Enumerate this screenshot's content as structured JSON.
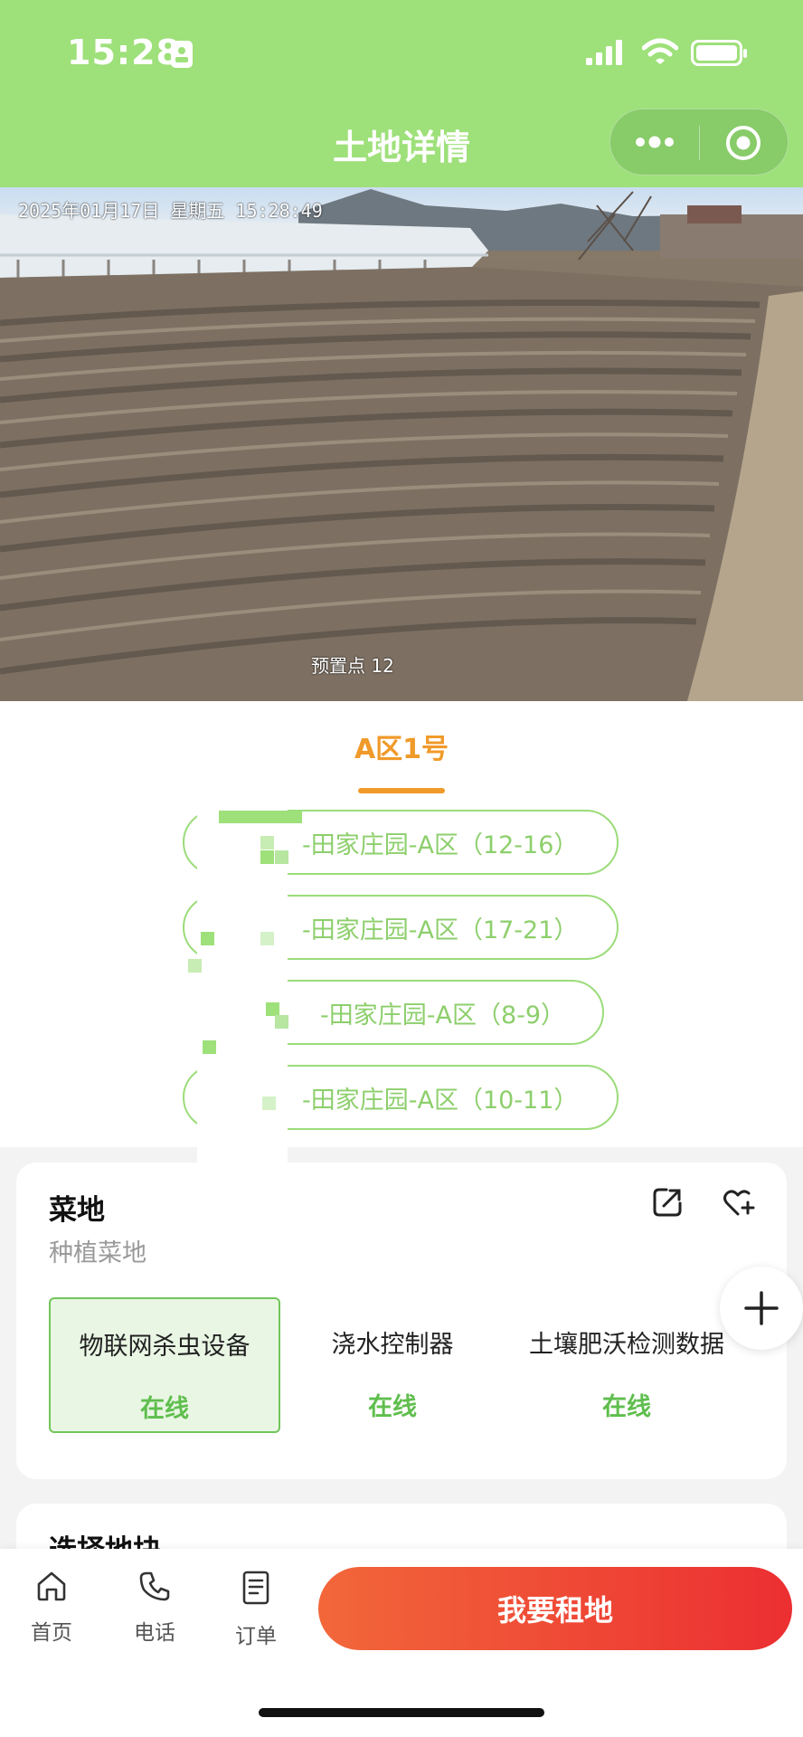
{
  "status_bar": {
    "time": "15:28"
  },
  "header": {
    "title": "土地详情"
  },
  "camera": {
    "timestamp": "2025年01月17日 星期五 15:28:49",
    "preset": "预置点 12"
  },
  "zone": {
    "active_tab": "A区1号"
  },
  "plots": [
    {
      "label": "-田家庄园-A区（12-16）"
    },
    {
      "label": "-田家庄园-A区（17-21）"
    },
    {
      "label": "-田家庄园-A区（8-9）"
    },
    {
      "label": "-田家庄园-A区（10-11）"
    }
  ],
  "land": {
    "title": "菜地",
    "subtitle": "种植菜地"
  },
  "devices": [
    {
      "name": "物联网杀虫设备",
      "status": "在线"
    },
    {
      "name": "浇水控制器",
      "status": "在线"
    },
    {
      "name": "土壤肥沃检测数据",
      "status": "在线"
    }
  ],
  "select_section": {
    "title": "选择地块"
  },
  "nav": {
    "home": "首页",
    "phone": "电话",
    "orders": "订单"
  },
  "cta": {
    "label": "我要租地"
  },
  "colors": {
    "header_green": "#9ee07a",
    "accent_orange": "#f09a2a",
    "online_green": "#5fbe4d",
    "cta_start": "#f2673a",
    "cta_end": "#ec2f32"
  }
}
